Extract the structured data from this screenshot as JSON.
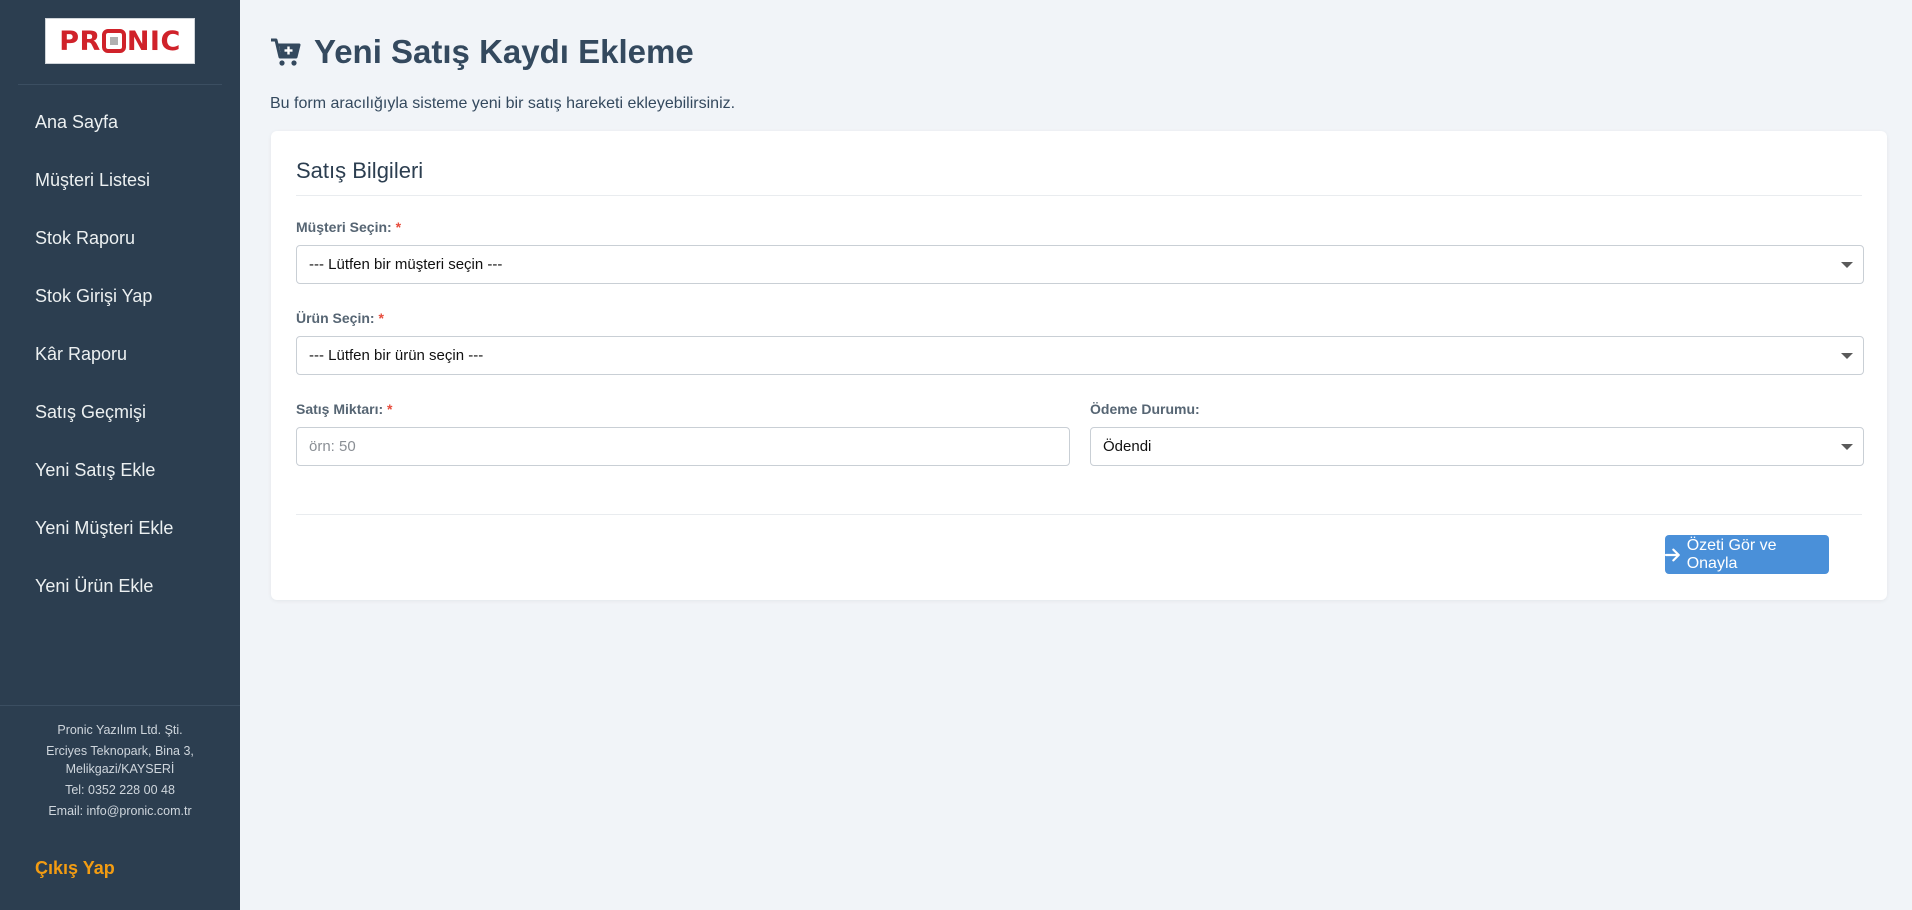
{
  "brand": {
    "logo_text": "PRONIC"
  },
  "sidebar": {
    "items": [
      {
        "label": "Ana Sayfa"
      },
      {
        "label": "Müşteri Listesi"
      },
      {
        "label": "Stok Raporu"
      },
      {
        "label": "Stok Girişi Yap"
      },
      {
        "label": "Kâr Raporu"
      },
      {
        "label": "Satış Geçmişi"
      },
      {
        "label": "Yeni Satış Ekle"
      },
      {
        "label": "Yeni Müşteri Ekle"
      },
      {
        "label": "Yeni Ürün Ekle"
      }
    ],
    "footer": {
      "company": "Pronic Yazılım Ltd. Şti.",
      "address1": "Erciyes Teknopark, Bina 3,",
      "address2": "Melikgazi/KAYSERİ",
      "phone": "Tel: 0352 228 00 48",
      "email": "Email: info@pronic.com.tr"
    },
    "logout_label": "Çıkış Yap"
  },
  "header": {
    "title": "Yeni Satış Kaydı Ekleme",
    "subtitle": "Bu form aracılığıyla sisteme yeni bir satış hareketi ekleyebilirsiniz."
  },
  "form": {
    "section_title": "Satış Bilgileri",
    "customer": {
      "label": "Müşteri Seçin:",
      "required_mark": "*",
      "value": "--- Lütfen bir müşteri seçin ---"
    },
    "product": {
      "label": "Ürün Seçin:",
      "required_mark": "*",
      "value": "--- Lütfen bir ürün seçin ---"
    },
    "quantity": {
      "label": "Satış Miktarı:",
      "required_mark": "*",
      "placeholder": "örn: 50"
    },
    "payment": {
      "label": "Ödeme Durumu:",
      "value": "Ödendi"
    },
    "submit_label": "Özeti Gör ve Onayla"
  },
  "icons": {
    "title_icon": "cart-plus-icon",
    "submit_icon": "arrow-right-icon"
  },
  "colors": {
    "sidebar_bg": "#2c3e50",
    "logout": "#f39c12",
    "primary_button": "#4a90d9",
    "required": "#e74c3c"
  }
}
